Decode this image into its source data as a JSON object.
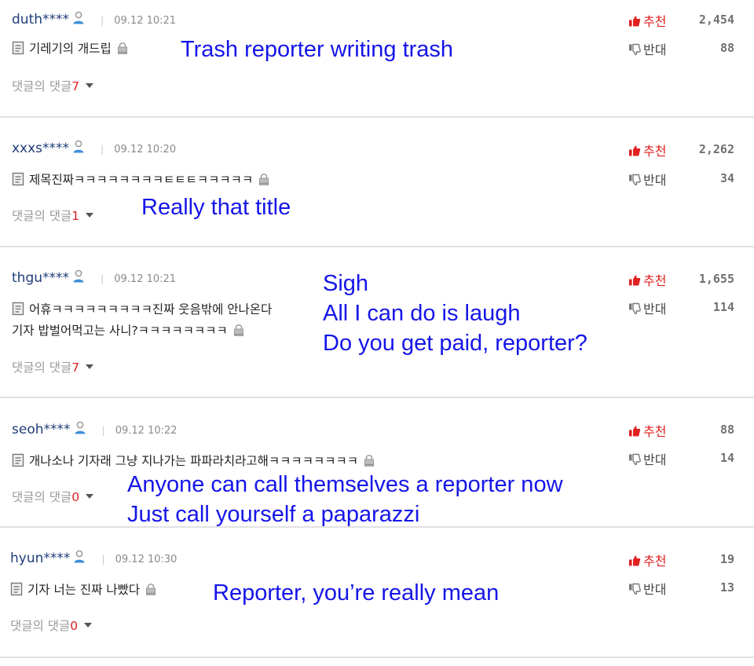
{
  "labels": {
    "replies": "댓글의 댓글",
    "upvote": "추천",
    "downvote": "반대"
  },
  "colors": {
    "username": "#1f3d78",
    "upvote": "#e02020",
    "translation": "#1515e8"
  },
  "icons": [
    "person-icon",
    "document-icon",
    "lock-icon",
    "thumbs-up-icon",
    "thumbs-down-icon",
    "caret-down-icon"
  ],
  "comments": [
    {
      "user": "duth****",
      "time": "09.12 10:21",
      "lines": [
        "기레기의 개드립"
      ],
      "reply_count": "7",
      "up": "2,454",
      "down": "88",
      "translation": [
        "Trash reporter writing trash"
      ]
    },
    {
      "user": "xxxs****",
      "time": "09.12 10:20",
      "lines": [
        "제목진짜ㅋㅋㅋㅋㅋㅋㅋㅋㅌㅌㅌㅋㅋㅋㅋㅋ"
      ],
      "reply_count": "1",
      "up": "2,262",
      "down": "34",
      "translation": [
        "Really that title"
      ]
    },
    {
      "user": "thgu****",
      "time": "09.12 10:21",
      "lines": [
        "어휴ㅋㅋㅋㅋㅋㅋㅋㅋㅋ진짜 웃음밖에 안나온다",
        "기자 밥벌어먹고는 사니?ㅋㅋㅋㅋㅋㅋㅋㅋ"
      ],
      "reply_count": "7",
      "up": "1,655",
      "down": "114",
      "translation": [
        "Sigh",
        "All I can do is laugh",
        "Do you get paid, reporter?"
      ]
    },
    {
      "user": "seoh****",
      "time": "09.12 10:22",
      "lines": [
        "개나소나 기자래 그냥 지나가는 파파라치라고해ㅋㅋㅋㅋㅋㅋㅋㅋ"
      ],
      "reply_count": "0",
      "up": "88",
      "down": "14",
      "translation": [
        "Anyone can call themselves a reporter now",
        "Just call yourself a paparazzi"
      ]
    },
    {
      "user": "hyun****",
      "time": "09.12 10:30",
      "lines": [
        "기자 너는 진짜 나빴다"
      ],
      "reply_count": "0",
      "up": "19",
      "down": "13",
      "translation": [
        "Reporter, you’re really mean"
      ]
    }
  ]
}
